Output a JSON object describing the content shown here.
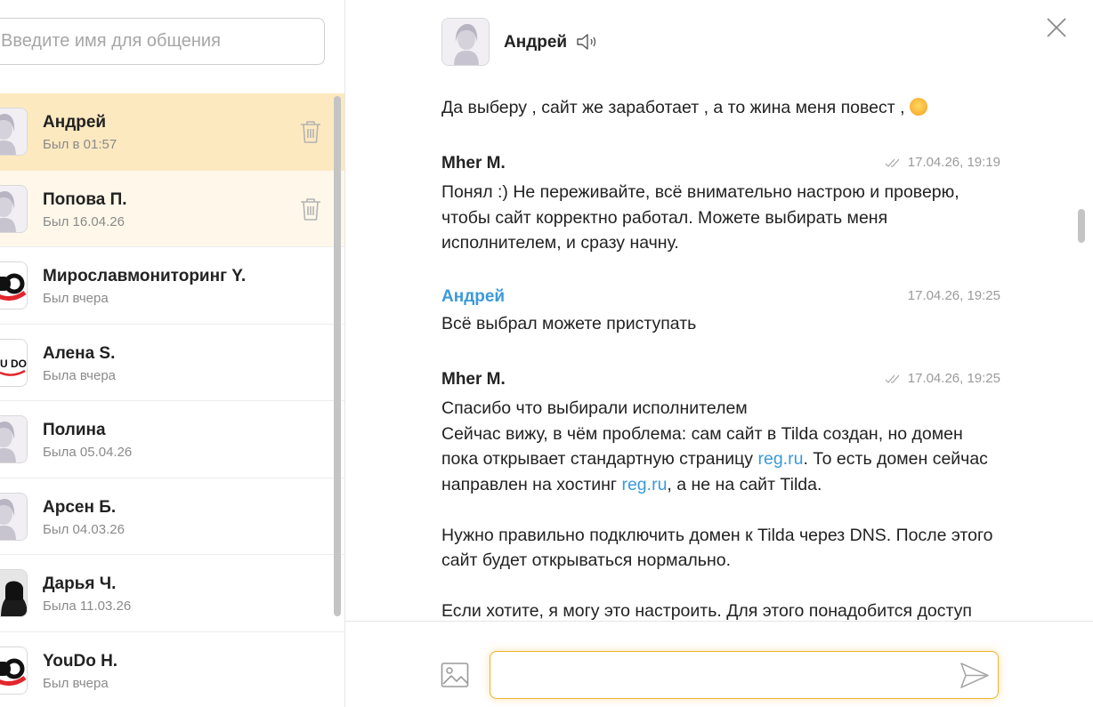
{
  "search": {
    "placeholder": "Введите имя для общения"
  },
  "contacts": [
    {
      "name": "Андрей",
      "status": "Был в 01:57",
      "avatar": "default-avatar",
      "state": "active",
      "trash": true
    },
    {
      "name": "Попова П.",
      "status": "Был 16.04.26",
      "avatar": "default-avatar",
      "state": "hover",
      "trash": true
    },
    {
      "name": "Мирославмониторинг Y.",
      "status": "Был вчера",
      "avatar": "youdo-logo",
      "state": "",
      "trash": false
    },
    {
      "name": "Алена S.",
      "status": "Была вчера",
      "avatar": "youdo-logo-small",
      "state": "",
      "trash": false
    },
    {
      "name": "Полина",
      "status": "Была 05.04.26",
      "avatar": "default-avatar",
      "state": "",
      "trash": false
    },
    {
      "name": "Арсен Б.",
      "status": "Был 04.03.26",
      "avatar": "default-avatar",
      "state": "",
      "trash": false
    },
    {
      "name": "Дарья Ч.",
      "status": "Была 11.03.26",
      "avatar": "photo-avatar",
      "state": "",
      "trash": false
    },
    {
      "name": "YouDo H.",
      "status": "Был вчера",
      "avatar": "youdo-logo",
      "state": "",
      "trash": false
    }
  ],
  "chat": {
    "name": "Андрей",
    "messages": [
      {
        "author": "",
        "time": "",
        "read": false,
        "lines": [
          "Да выберу , сайт же заработает , а то жина меня повест , "
        ],
        "emoji": true
      },
      {
        "author": "Mher M.",
        "author_blue": false,
        "time": "17.04.26, 19:19",
        "read": true,
        "lines": [
          "Понял :) Не переживайте, всё внимательно настрою и проверю, чтобы сайт корректно работал. Можете выбирать меня исполнителем, и сразу начну."
        ]
      },
      {
        "author": "Андрей",
        "author_blue": true,
        "time": "17.04.26, 19:25",
        "read": false,
        "lines": [
          "Всё выбрал можете приступать"
        ]
      },
      {
        "author": "Mher M.",
        "author_blue": false,
        "time": "17.04.26, 19:25",
        "read": true,
        "p1": "Спасибо что выбирали исполнителем",
        "p2a": "Сейчас вижу, в чём проблема: сам сайт в Tilda создан, но домен пока открывает стандартную страницу ",
        "link1": "reg.ru",
        "p2b": ". То есть домен сейчас направлен на хостинг ",
        "link2": "reg.ru",
        "p2c": ", а не на сайт Tilda.",
        "p3": "Нужно правильно подключить домен к Tilda через DNS. После этого сайт будет открываться нормально.",
        "p4": "Если хотите, я могу это настроить. Для этого понадобится доступ"
      }
    ]
  },
  "composer": {
    "value": "",
    "placeholder": ""
  },
  "colors": {
    "accent": "#f0b12a",
    "active_row": "#fde9c0",
    "link": "#3a9ad9"
  },
  "icons": [
    "trash-icon",
    "speaker-icon",
    "close-icon",
    "image-attach-icon",
    "send-icon",
    "read-check-icon"
  ]
}
